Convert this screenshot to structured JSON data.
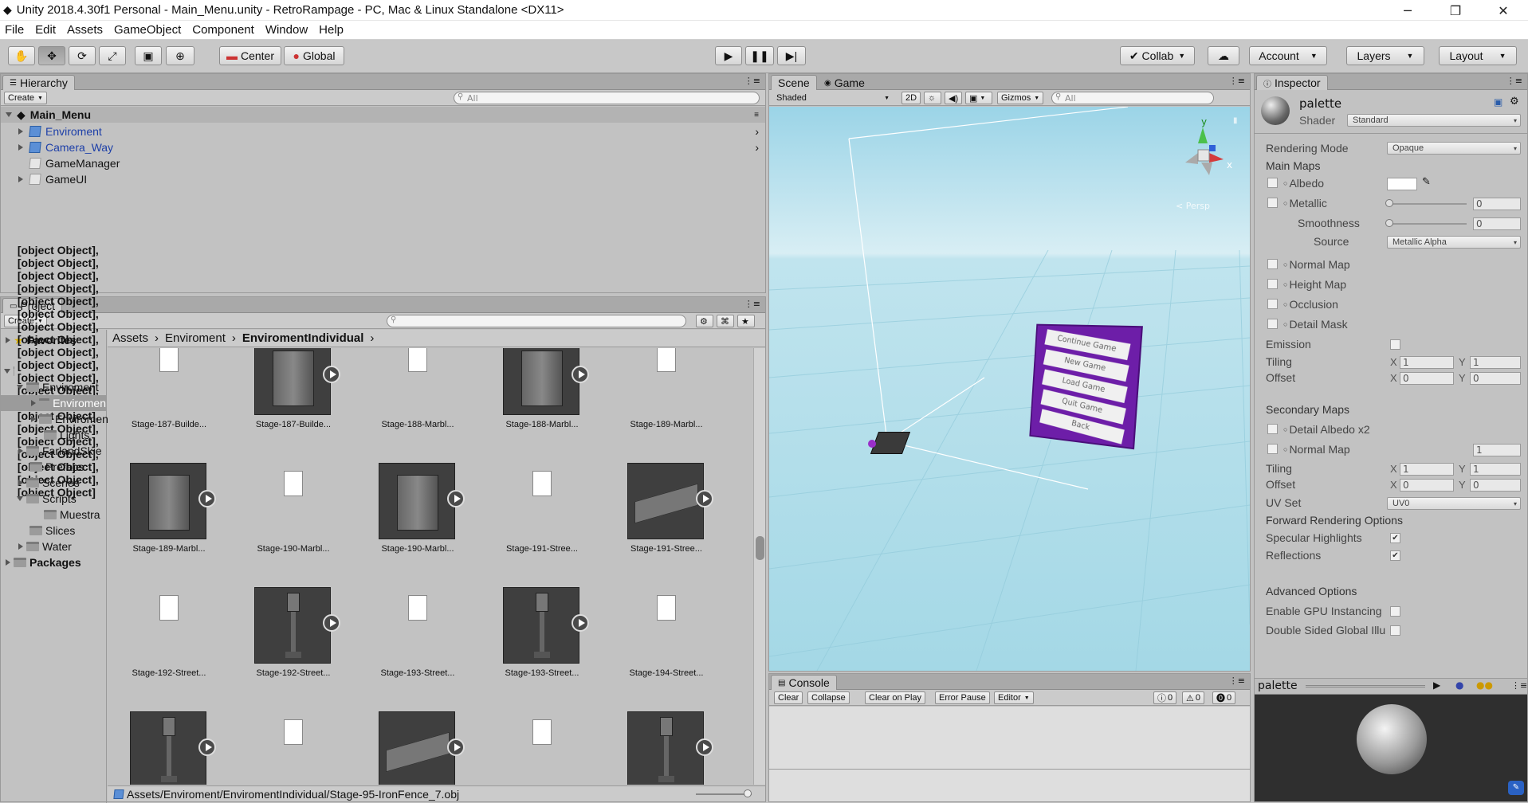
{
  "window": {
    "title": "Unity 2018.4.30f1 Personal - Main_Menu.unity - RetroRampage - PC, Mac & Linux Standalone <DX11>",
    "minimize": "─",
    "maximize": "❐",
    "close": "✕"
  },
  "menu": [
    "File",
    "Edit",
    "Assets",
    "GameObject",
    "Component",
    "Window",
    "Help"
  ],
  "toolbar": {
    "center": "Center",
    "global": "Global",
    "collab": "Collab",
    "account": "Account",
    "layers": "Layers",
    "layout": "Layout"
  },
  "hierarchy": {
    "tab": "Hierarchy",
    "create": "Create",
    "search_placeholder": "All",
    "scene": "Main_Menu",
    "items": [
      {
        "name": "Enviroment",
        "prefab": true,
        "expandable": true
      },
      {
        "name": "Camera_Way",
        "prefab": true,
        "expandable": true
      },
      {
        "name": "GameManager",
        "prefab": false,
        "expandable": false
      },
      {
        "name": "GameUI",
        "prefab": false,
        "expandable": true
      }
    ]
  },
  "project": {
    "tab": "Project",
    "create": "Create",
    "favorites": "Favorites",
    "assets": [
      {
        "label": "Stage-187-Builde...",
        "type": "doc"
      },
      {
        "label": "Stage-187-Builde...",
        "type": "building"
      },
      {
        "label": "Stage-188-Marbl...",
        "type": "doc"
      },
      {
        "label": "Stage-188-Marbl...",
        "type": "building"
      },
      {
        "label": "Stage-189-Marbl...",
        "type": "doc"
      },
      {
        "label": "Stage-189-Marbl...",
        "type": "building"
      },
      {
        "label": "Stage-190-Marbl...",
        "type": "doc"
      },
      {
        "label": "Stage-190-Marbl...",
        "type": "building"
      },
      {
        "label": "Stage-191-Stree...",
        "type": "doc"
      },
      {
        "label": "Stage-191-Stree...",
        "type": "road"
      },
      {
        "label": "Stage-192-Street...",
        "type": "doc"
      },
      {
        "label": "Stage-192-Street...",
        "type": "lamp"
      },
      {
        "label": "Stage-193-Street...",
        "type": "doc"
      },
      {
        "label": "Stage-193-Street...",
        "type": "lamp"
      },
      {
        "label": "Stage-194-Street...",
        "type": "doc"
      },
      {
        "label": "",
        "type": "lamp"
      },
      {
        "label": "",
        "type": "doc"
      },
      {
        "label": "",
        "type": "road"
      },
      {
        "label": "",
        "type": "doc"
      },
      {
        "label": "",
        "type": "lamp"
      }
    ],
    "packages": "Packages",
    "tree": [
      "Enviroment",
      "Enviromen",
      "Enviromen",
      "Lights",
      "FarlandSkie",
      "Prefabs",
      "Scenes",
      "Scripts",
      "Muestra",
      "Slices",
      "Water"
    ],
    "breadcrumb": [
      "Assets",
      "Enviroment",
      "EnviromentIndividual"
    ],
    "status_path": "Assets/Enviroment/EnviromentIndividual/Stage-95-IronFence_7.obj"
  },
  "scene": {
    "tab_scene": "Scene",
    "tab_game": "Game",
    "shading": "Shaded",
    "mode2d": "2D",
    "gizmos": "Gizmos",
    "search_placeholder": "All",
    "gizmo_x": "x",
    "gizmo_y": "y",
    "persp": "< Persp",
    "menu_buttons": [
      "Continue Game",
      "New Game",
      "Load Game",
      "Quit Game",
      "Back"
    ]
  },
  "console": {
    "tab": "Console",
    "buttons": [
      "Clear",
      "Collapse",
      "Clear on Play",
      "Error Pause",
      "Editor"
    ],
    "counts": [
      "0",
      "0",
      "0"
    ]
  },
  "inspector": {
    "tab": "Inspector",
    "name": "palette",
    "shader_label": "Shader",
    "shader": "Standard",
    "rendering_mode_label": "Rendering Mode",
    "rendering_mode": "Opaque",
    "main_maps": "Main Maps",
    "albedo": "Albedo",
    "metallic": "Metallic",
    "metallic_value": "0",
    "smoothness": "Smoothness",
    "smoothness_value": "0",
    "source": "Source",
    "source_value": "Metallic Alpha",
    "normal_map": "Normal Map",
    "height_map": "Height Map",
    "occlusion": "Occlusion",
    "detail_mask": "Detail Mask",
    "emission": "Emission",
    "tiling": "Tiling",
    "offset": "Offset",
    "tiling_x": "1",
    "tiling_y": "1",
    "offset_x": "0",
    "offset_y": "0",
    "secondary_maps": "Secondary Maps",
    "detail_albedo": "Detail Albedo x2",
    "normal_map2": "Normal Map",
    "normal_map2_value": "1",
    "tiling2_x": "1",
    "tiling2_y": "1",
    "offset2_x": "0",
    "offset2_y": "0",
    "uv_set": "UV Set",
    "uv_set_value": "UV0",
    "forward_options": "Forward Rendering Options",
    "specular": "Specular Highlights",
    "reflections": "Reflections",
    "advanced": "Advanced Options",
    "gpu_instancing": "Enable GPU Instancing",
    "double_sided": "Double Sided Global Illumination",
    "x": "X",
    "y": "Y",
    "preview_label": "palette"
  }
}
